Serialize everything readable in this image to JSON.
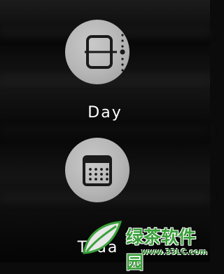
{
  "options": [
    {
      "label": "Day",
      "icon": "day-view-icon"
    },
    {
      "label": "Toda",
      "icon": "month-grid-icon"
    }
  ],
  "watermark": {
    "name": "绿茶软件园",
    "url": "www.33LC.com"
  },
  "colors": {
    "circle": "#b8b8b8",
    "icon": "#1a1a1a",
    "background": "#0b0b0b",
    "watermark": "#3aa03a"
  }
}
